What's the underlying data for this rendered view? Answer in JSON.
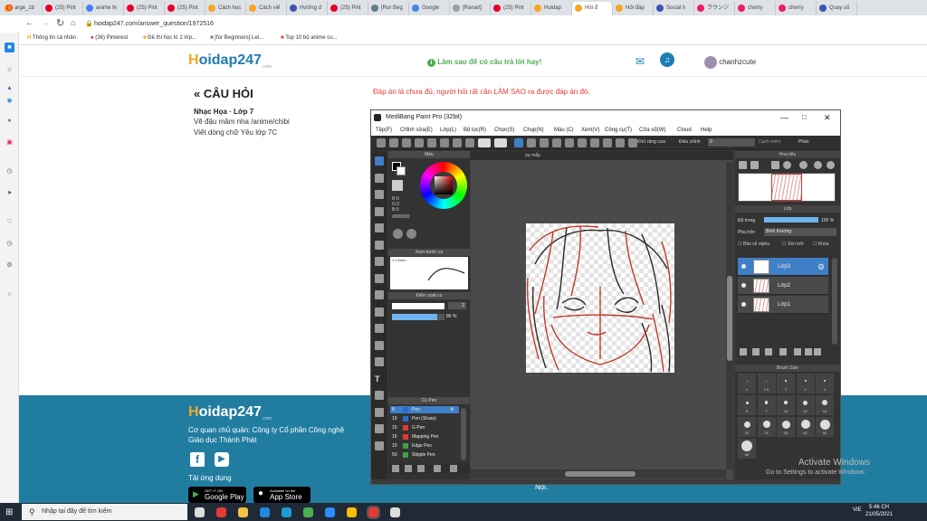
{
  "browser": {
    "tabs": [
      {
        "label": "arge_1b",
        "color": "#ff9800"
      },
      {
        "label": "(25) Pint",
        "color": "#e60023"
      },
      {
        "label": "anime fe",
        "color": "#4285f4"
      },
      {
        "label": "(25) Pint",
        "color": "#e60023"
      },
      {
        "label": "(25) Pint",
        "color": "#e60023"
      },
      {
        "label": "Cách học",
        "color": "#f5a623"
      },
      {
        "label": "Cách viế",
        "color": "#f5a623"
      },
      {
        "label": "Hướng d",
        "color": "#3f51b5"
      },
      {
        "label": "(25) Pint",
        "color": "#e60023"
      },
      {
        "label": "[Ror Beg",
        "color": "#607d8b"
      },
      {
        "label": "Google",
        "color": "#4285f4"
      },
      {
        "label": "[Ranart]",
        "color": "#9e9e9e"
      },
      {
        "label": "(25) Pint",
        "color": "#e60023"
      },
      {
        "label": "Hoidap",
        "color": "#f5a623"
      },
      {
        "label": "Hỏi đ",
        "color": "#f5a623"
      },
      {
        "label": "Hỏi đáp",
        "color": "#f5a623"
      },
      {
        "label": "Social h",
        "color": "#3f51b5"
      },
      {
        "label": "ラウンジ",
        "color": "#e91e63"
      },
      {
        "label": "cherry",
        "color": "#e91e63"
      },
      {
        "label": "cherry",
        "color": "#e91e63"
      },
      {
        "label": "Quay số",
        "color": "#3f51b5"
      }
    ],
    "url": "hoidap247.com/answer_question/1972516",
    "bookmarks": [
      "Thông tin cá nhân",
      "(36) Pinterest",
      "Đề thi học kì 2 lớp...",
      "[for Beginners] Let...",
      "Top 10 bộ anime cu..."
    ]
  },
  "site": {
    "logo_h": "H",
    "logo_rest": "oidap247",
    "logo_sub": ".com",
    "notice": "Làm sao để có câu trả lời hay!",
    "username": "chanhzcute",
    "question_heading": "« CÂU HỎI",
    "subject": "Nhạc Họa · Lớp 7",
    "question_lines": [
      "Vẽ đậu mầm nha /anime/chibi",
      "Viết dòng chữ Yêu lớp 7C"
    ],
    "warning": "Đáp án là chưa đủ, người hỏi rất cần LÀM SAO ra được đáp án đó.",
    "footer": {
      "company_line1": "Cơ quan chủ quản: Công ty Cổ phần Công nghệ",
      "company_line2": "Giáo dục Thành Phát",
      "download_label": "Tải ứng dụng",
      "google_play": "Google Play",
      "app_store": "App Store",
      "google_play_small": "GET IT ON",
      "app_store_small": "Available on the",
      "noi": "Nội."
    }
  },
  "paint": {
    "title": "MediBang Paint Pro (32bit)",
    "menu": [
      "Tệp(F)",
      "Chỉnh sửa(E)",
      "Lớp(L)",
      "Bộ lọc(R)",
      "Chọn(S)",
      "Chụp(N)",
      "Màu (C)",
      "Xem(V)",
      "Công cụ(T)",
      "Cửa sổ(W)",
      "Cloud",
      "Help"
    ],
    "toolbar": {
      "antialias": "Khử răng cưa",
      "correction_label": "Điều chỉnh",
      "correction_value": "0",
      "canvas_protect": "Cạnh mềm",
      "right": "Phần"
    },
    "color_panel": {
      "title": "Màu",
      "r": "R:0",
      "g": "G:0",
      "b": "B:0",
      "hex": "#000000"
    },
    "brush_preview": {
      "title": "Xem trước cọ",
      "size": "1.0.5mm"
    },
    "brush_control": {
      "title": "Kiểm soát cọ",
      "size": "2",
      "opacity": "86 %",
      "opacity_fraction": 0.86
    },
    "brush_list": {
      "title": "Cọ Pen",
      "items": [
        {
          "num": "8",
          "name": "Pen",
          "color": "#2e6ad1",
          "selected": true
        },
        {
          "num": "10",
          "name": "Pen (Sharp)",
          "color": "#2e6ad1",
          "selected": false
        },
        {
          "num": "15",
          "name": "G Pen",
          "color": "#e53935",
          "selected": false
        },
        {
          "num": "15",
          "name": "Mapping Pen",
          "color": "#e53935",
          "selected": false
        },
        {
          "num": "10",
          "name": "Edge Pen",
          "color": "#43a047",
          "selected": false
        },
        {
          "num": "50",
          "name": "Stipple Pen",
          "color": "#43a047",
          "selected": false
        }
      ]
    },
    "canvas_tab": "sự mắp",
    "navigator_title": "Hoa tiêu",
    "layer_panel": {
      "title": "Lớp",
      "opacity_label": "Độ trong",
      "opacity_value": "100 %",
      "blend_label": "Pha trộn",
      "blend_value": "Bình thường",
      "opt_protect": "Bảo vệ alpha",
      "opt_clip": "Xén bớt",
      "opt_lock": "Khóa",
      "layers": [
        {
          "name": "Lớp3",
          "selected": true
        },
        {
          "name": "Lớp2",
          "selected": false
        },
        {
          "name": "Lớp1",
          "selected": false
        }
      ]
    },
    "brush_size_panel": {
      "title": "Brush Size",
      "labels": [
        "1",
        "1.5",
        "2",
        "3",
        "4",
        "5",
        "7",
        "10",
        "12",
        "15",
        "20",
        "25",
        "30",
        "40",
        "50",
        "60"
      ]
    }
  },
  "watermark": {
    "line1": "Activate Windows",
    "line2": "Go to Settings to activate Windows."
  },
  "taskbar": {
    "search_placeholder": "Nhập tại đây để tìm kiếm",
    "lang": "VIE",
    "time": "5:46 CH",
    "date": "21/05/2021"
  }
}
